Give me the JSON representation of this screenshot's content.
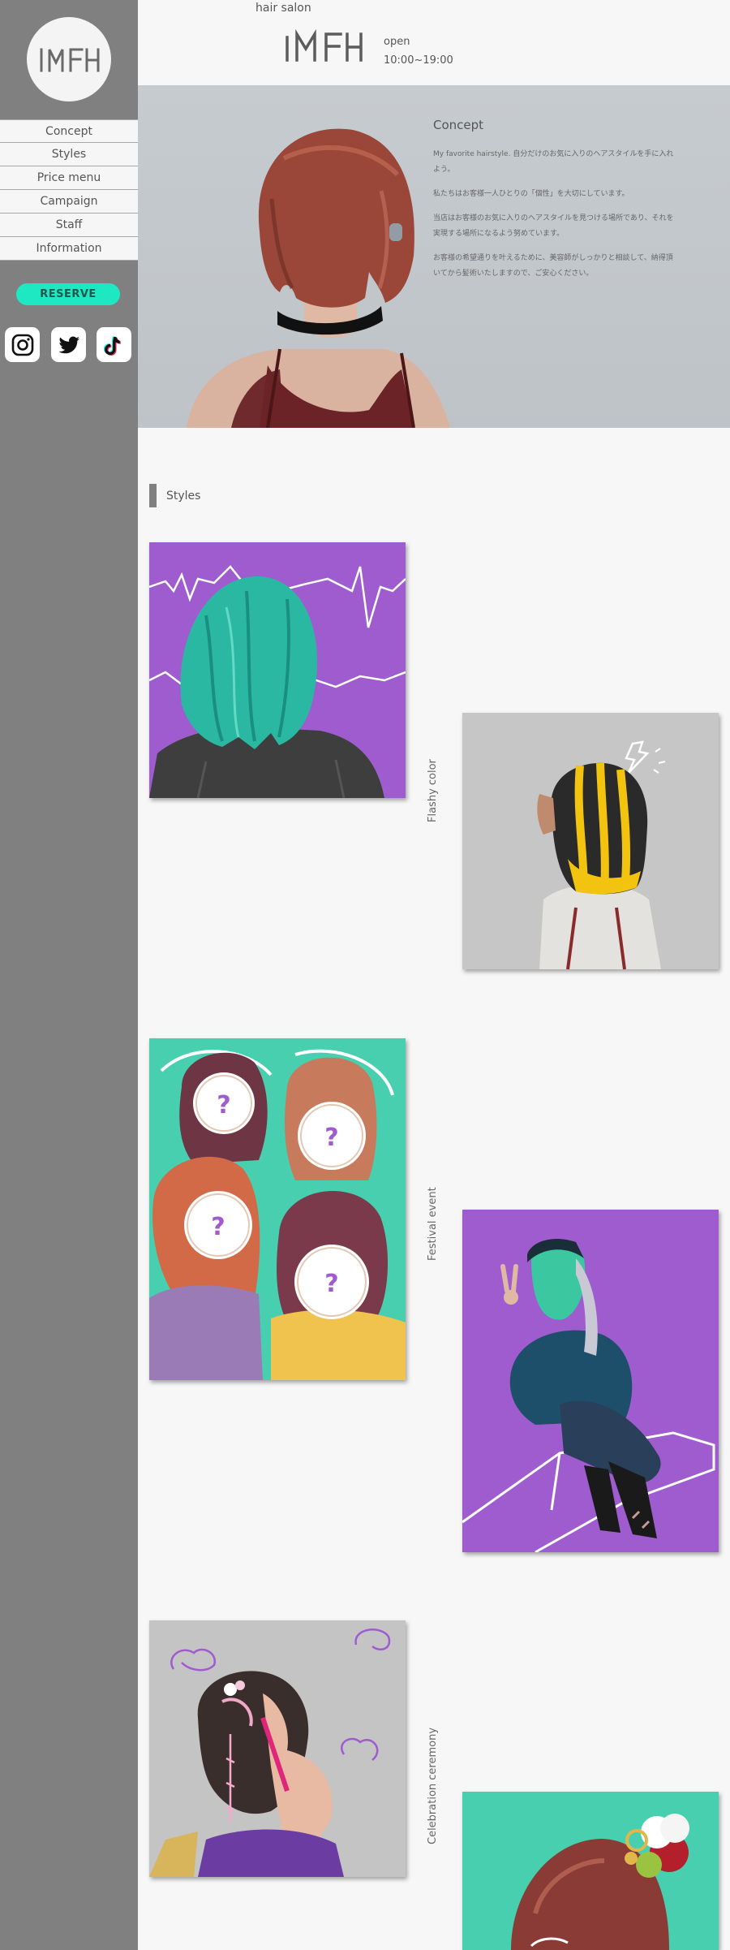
{
  "sidebar": {
    "logo_text": "MFH",
    "nav": [
      "Concept",
      "Styles",
      "Price menu",
      "Campaign",
      "Staff",
      "Information"
    ],
    "reserve_label": "RESERVE"
  },
  "header": {
    "tagline": "hair salon",
    "brand": "MFH",
    "open_label": "open",
    "hours": "10:00~19:00"
  },
  "concept": {
    "title": "Concept",
    "paragraphs": [
      "My favorite hairstyle. 自分だけのお気に入りのヘアスタイルを手に入れよう。",
      "私たちはお客様一人ひとりの「個性」を大切にしています。",
      "当店はお客様のお気に入りのヘアスタイルを見つける場所であり、それを実現する場所になるよう努めています。",
      "お客様の希望通りを叶えるために、美容師がしっかりと相談して、納得頂いてから髪術いたしますので、ご安心ください。"
    ]
  },
  "styles": {
    "title": "Styles",
    "categories": [
      "Flashy color",
      "Festival event",
      "Celebration ceremony"
    ]
  },
  "colors": {
    "sidebar": "#808080",
    "accent": "#1de8c1",
    "purple": "#9f5ccf",
    "teal": "#48cfaf"
  }
}
